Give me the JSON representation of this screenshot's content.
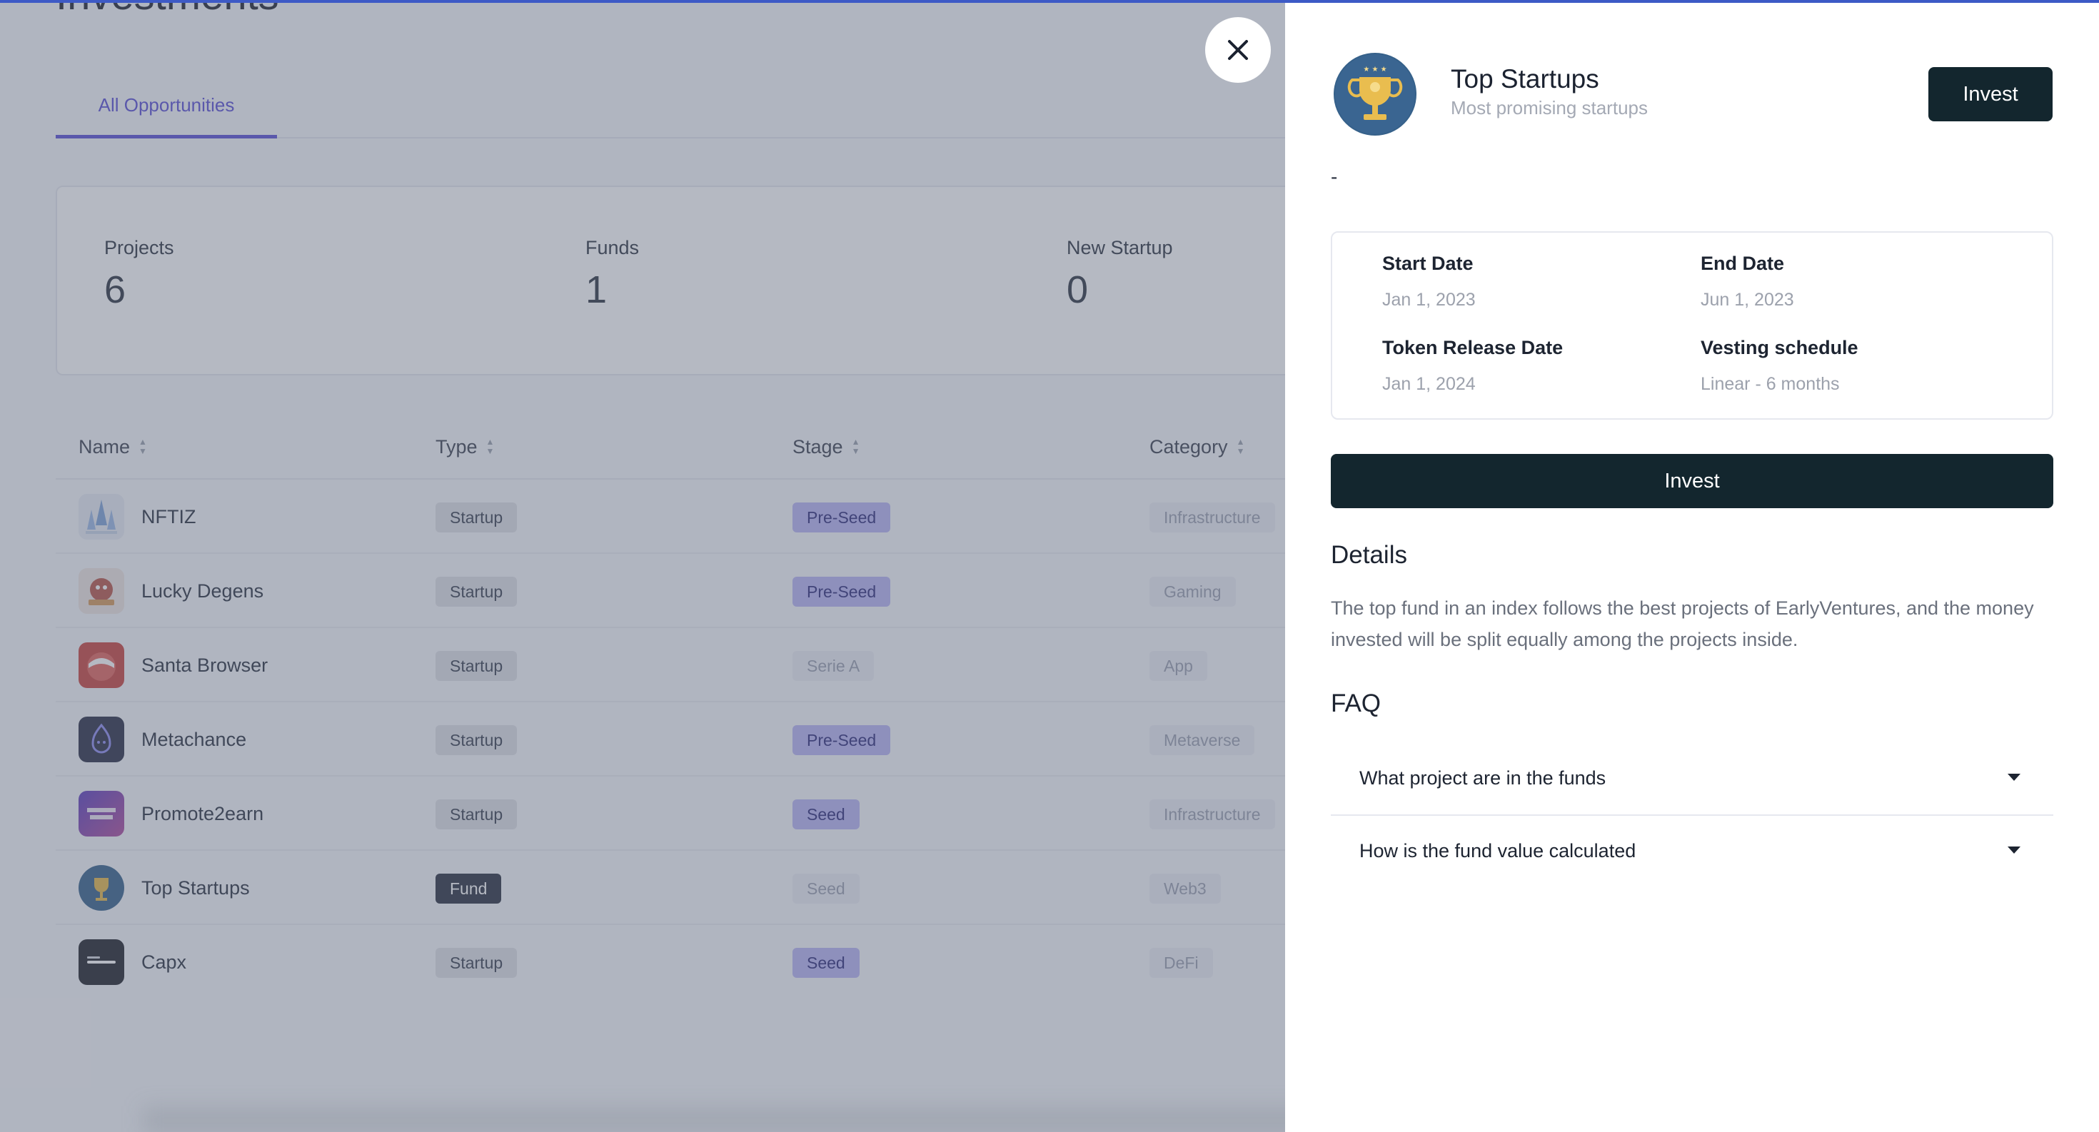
{
  "page": {
    "title": "Investments",
    "tab_active": "All Opportunities",
    "stats": [
      {
        "label": "Projects",
        "value": "6"
      },
      {
        "label": "Funds",
        "value": "1"
      },
      {
        "label": "New Startup",
        "value": "0"
      }
    ],
    "table": {
      "headers": [
        "Name",
        "Type",
        "Stage",
        "Category"
      ],
      "rows": [
        {
          "name": "NFTIZ",
          "type": "Startup",
          "stage": "Pre-Seed",
          "category": "Infrastructure"
        },
        {
          "name": "Lucky Degens",
          "type": "Startup",
          "stage": "Pre-Seed",
          "category": "Gaming"
        },
        {
          "name": "Santa Browser",
          "type": "Startup",
          "stage": "Serie A",
          "category": "App"
        },
        {
          "name": "Metachance",
          "type": "Startup",
          "stage": "Pre-Seed",
          "category": "Metaverse"
        },
        {
          "name": "Promote2earn",
          "type": "Startup",
          "stage": "Seed",
          "category": "Infrastructure"
        },
        {
          "name": "Top Startups",
          "type": "Fund",
          "stage": "Seed",
          "category": "Web3"
        },
        {
          "name": "Capx",
          "type": "Startup",
          "stage": "Seed",
          "category": "DeFi"
        }
      ]
    }
  },
  "drawer": {
    "title": "Top Startups",
    "subtitle": "Most promising startups",
    "invest_label": "Invest",
    "dash": "-",
    "fields": {
      "start_date_label": "Start Date",
      "start_date_value": "Jan 1, 2023",
      "end_date_label": "End Date",
      "end_date_value": "Jun 1, 2023",
      "token_release_label": "Token Release Date",
      "token_release_value": "Jan 1, 2024",
      "vesting_label": "Vesting schedule",
      "vesting_value": "Linear - 6 months"
    },
    "details_heading": "Details",
    "details_text": "The top fund in an index follows the best projects of EarlyVentures, and the money invested will be split equally among the projects inside.",
    "faq_heading": "FAQ",
    "faq": [
      "What project are in the funds",
      "How is the fund value calculated"
    ]
  },
  "icons": {
    "close": "close-icon",
    "sort": "sort-icon",
    "caret": "chevron-down-icon"
  },
  "colors": {
    "accent": "#5a4fd6",
    "dark_button": "#13262e",
    "overlay": "#5c6478"
  }
}
